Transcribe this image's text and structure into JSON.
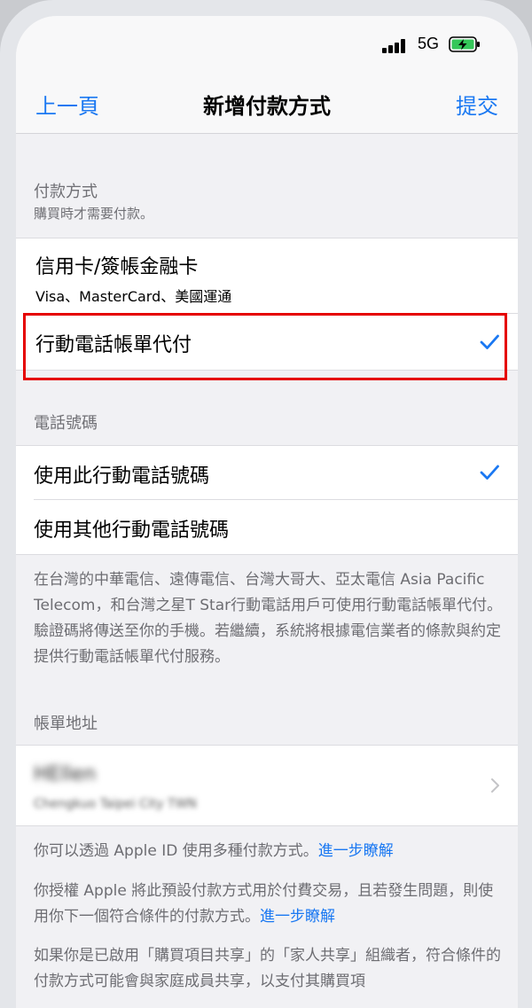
{
  "status_bar": {
    "network": "5G"
  },
  "nav": {
    "back": "上一頁",
    "title": "新增付款方式",
    "submit": "提交"
  },
  "payment_section": {
    "header": "付款方式",
    "subheader": "購買時才需要付款。",
    "options": [
      {
        "title": "信用卡/簽帳金融卡",
        "subtitle": "Visa、MasterCard、美國運通",
        "selected": false
      },
      {
        "title": "行動電話帳單代付",
        "selected": true
      }
    ]
  },
  "phone_section": {
    "header": "電話號碼",
    "options": [
      {
        "title": "使用此行動電話號碼",
        "selected": true
      },
      {
        "title": "使用其他行動電話號碼",
        "selected": false
      }
    ],
    "footer": "在台灣的中華電信、遠傳電信、台灣大哥大、亞太電信 Asia Pacific Telecom，和台灣之星T Star行動電話用戶可使用行動電話帳單代付。驗證碼將傳送至你的手機。若繼續，系統將根據電信業者的條款與約定提供行動電話帳單代付服務。"
  },
  "billing_section": {
    "header": "帳單地址",
    "name": "HEllen",
    "address": "Chengkuo Taipei City TWN"
  },
  "footer_notes": {
    "note1_text": "你可以透過 Apple ID 使用多種付款方式。",
    "note1_link": "進一步瞭解",
    "note2_text": "你授權 Apple 將此預設付款方式用於付費交易，且若發生問題，則使用你下一個符合條件的付款方式。",
    "note2_link": "進一步瞭解",
    "note3_text": "如果你是已啟用「購買項目共享」的「家人共享」組織者，符合條件的付款方式可能會與家庭成員共享，以支付其購買項"
  },
  "colors": {
    "accent": "#1a78f2",
    "highlight": "#e50000"
  },
  "icons": [
    "signal-icon",
    "battery-charging-icon",
    "checkmark-icon",
    "chevron-right-icon"
  ]
}
